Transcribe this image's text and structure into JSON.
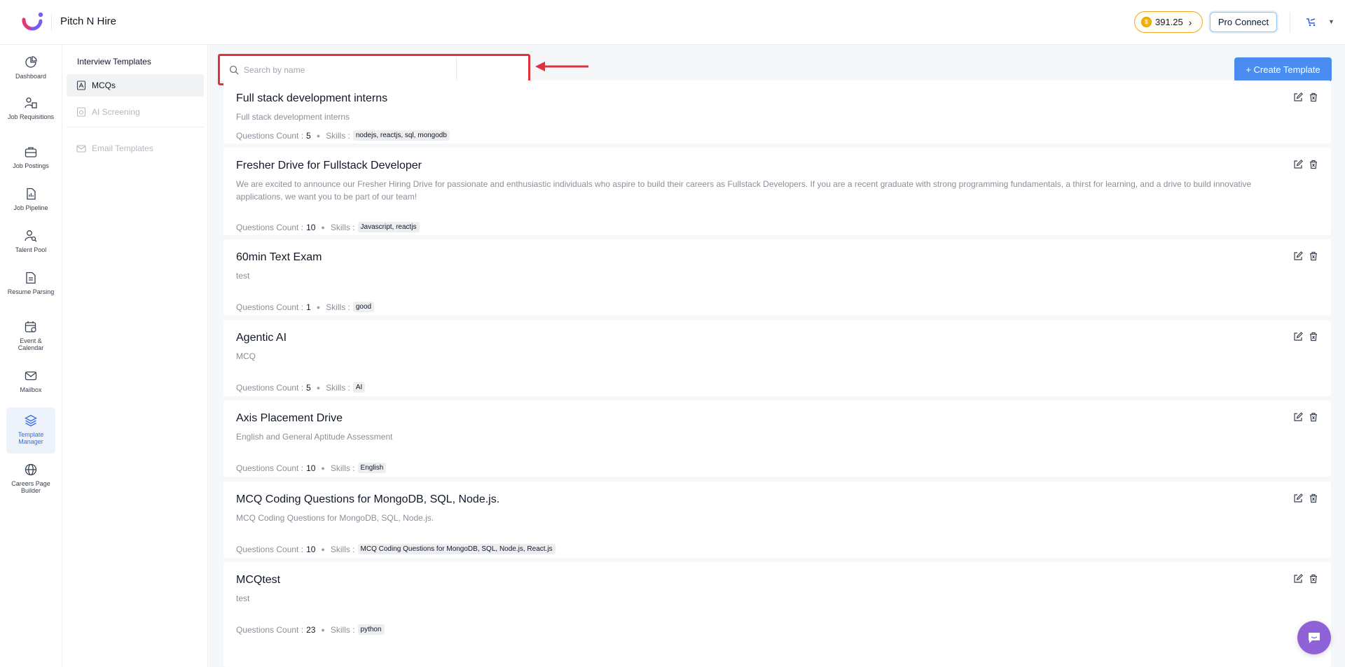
{
  "header": {
    "brand": "Pitch N Hire",
    "credits": "391.25",
    "pro_connect": "Pro Connect"
  },
  "leftnav": [
    {
      "label": "Dashboard",
      "icon": "dashboard-icon"
    },
    {
      "label": "Job Requisitions",
      "icon": "job-requisitions-icon"
    },
    {
      "label": "Job Postings",
      "icon": "briefcase-icon"
    },
    {
      "label": "Job Pipeline",
      "icon": "pipeline-icon"
    },
    {
      "label": "Talent Pool",
      "icon": "talent-pool-icon"
    },
    {
      "label": "Resume Parsing",
      "icon": "resume-icon"
    },
    {
      "label": "Event & Calendar",
      "icon": "calendar-icon"
    },
    {
      "label": "Mailbox",
      "icon": "mail-icon"
    },
    {
      "label": "Template Manager",
      "icon": "layers-icon"
    },
    {
      "label": "Careers Page Builder",
      "icon": "globe-icon"
    }
  ],
  "subnav": {
    "heading": "Interview Templates",
    "items": [
      {
        "label": "MCQs"
      },
      {
        "label": "AI Screening"
      },
      {
        "label": "Email Templates"
      }
    ]
  },
  "search": {
    "placeholder": "Search by name",
    "value": ""
  },
  "create_button": "+ Create Template",
  "labels": {
    "questions_count": "Questions Count :",
    "skills": "Skills :"
  },
  "templates": [
    {
      "title": "Full stack development interns",
      "description": "Full stack development interns",
      "count": "5",
      "skills": "nodejs, reactjs, sql, mongodb"
    },
    {
      "title": "Fresher Drive for Fullstack Developer",
      "description": "We are excited to announce our Fresher Hiring Drive for passionate and enthusiastic individuals who aspire to build their careers as Fullstack Developers. If you are a recent graduate with strong programming fundamentals, a thirst for learning, and a drive to build innovative applications, we want you to be part of our team!",
      "count": "10",
      "skills": "Javascript, reactjs"
    },
    {
      "title": "60min Text Exam",
      "description": "test",
      "count": "1",
      "skills": "good"
    },
    {
      "title": "Agentic AI",
      "description": "MCQ",
      "count": "5",
      "skills": "AI"
    },
    {
      "title": "Axis Placement Drive",
      "description": "English and General Aptitude Assessment",
      "count": "10",
      "skills": "English"
    },
    {
      "title": "MCQ Coding Questions for MongoDB, SQL, Node.js.",
      "description": "MCQ Coding Questions for MongoDB, SQL, Node.js.",
      "count": "10",
      "skills": "MCQ Coding Questions for MongoDB, SQL, Node.js, React.js"
    },
    {
      "title": "MCQtest",
      "description": "test",
      "count": "23",
      "skills": "python"
    }
  ],
  "colors": {
    "accent": "#4a8df0",
    "highlight": "#e0323e",
    "chat": "#8f62d8"
  }
}
